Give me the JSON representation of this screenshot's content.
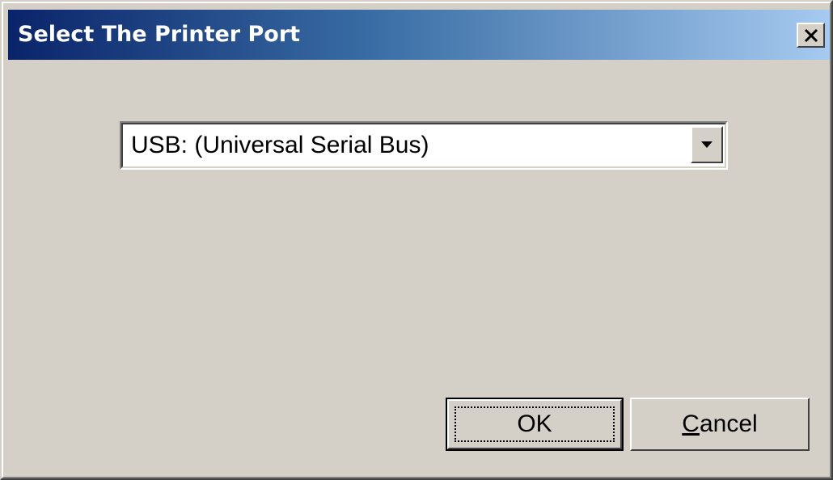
{
  "window": {
    "title": "Select The Printer Port",
    "close_icon": "close-icon"
  },
  "port_select": {
    "selected_value": "USB: (Universal Serial Bus)",
    "arrow_icon": "chevron-down-icon"
  },
  "buttons": {
    "ok_label": "OK",
    "cancel_label_mnemonic": "C",
    "cancel_label_rest": "ancel"
  },
  "colors": {
    "titlebar_start": "#0a246a",
    "titlebar_end": "#a6caf0",
    "dialog_face": "#d4d0c8"
  }
}
